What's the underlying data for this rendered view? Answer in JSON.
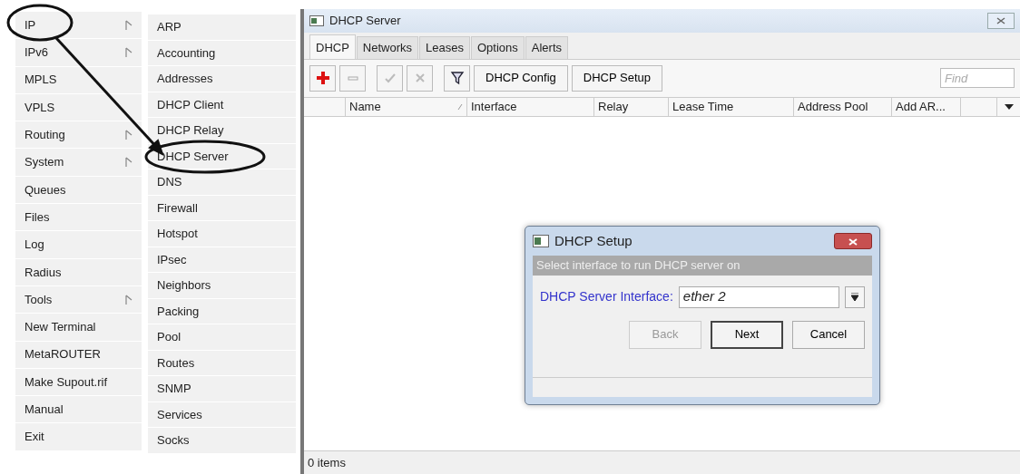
{
  "main_menu": [
    {
      "label": "IP",
      "submenu": true,
      "circled": true
    },
    {
      "label": "IPv6",
      "submenu": true,
      "circled": false
    },
    {
      "label": "MPLS",
      "submenu": false,
      "circled": false
    },
    {
      "label": "VPLS",
      "submenu": false,
      "circled": false
    },
    {
      "label": "Routing",
      "submenu": true,
      "circled": false
    },
    {
      "label": "System",
      "submenu": true,
      "circled": false
    },
    {
      "label": "Queues",
      "submenu": false,
      "circled": false
    },
    {
      "label": "Files",
      "submenu": false,
      "circled": false
    },
    {
      "label": "Log",
      "submenu": false,
      "circled": false
    },
    {
      "label": "Radius",
      "submenu": false,
      "circled": false
    },
    {
      "label": "Tools",
      "submenu": true,
      "circled": false
    },
    {
      "label": "New Terminal",
      "submenu": false,
      "circled": false
    },
    {
      "label": "MetaROUTER",
      "submenu": false,
      "circled": false
    },
    {
      "label": "Make Supout.rif",
      "submenu": false,
      "circled": false
    },
    {
      "label": "Manual",
      "submenu": false,
      "circled": false
    },
    {
      "label": "Exit",
      "submenu": false,
      "circled": false
    }
  ],
  "ip_submenu": [
    {
      "label": "ARP",
      "circled": false
    },
    {
      "label": "Accounting",
      "circled": false
    },
    {
      "label": "Addresses",
      "circled": false
    },
    {
      "label": "DHCP Client",
      "circled": false
    },
    {
      "label": "DHCP Relay",
      "circled": false
    },
    {
      "label": "DHCP Server",
      "circled": true
    },
    {
      "label": "DNS",
      "circled": false
    },
    {
      "label": "Firewall",
      "circled": false
    },
    {
      "label": "Hotspot",
      "circled": false
    },
    {
      "label": "IPsec",
      "circled": false
    },
    {
      "label": "Neighbors",
      "circled": false
    },
    {
      "label": "Packing",
      "circled": false
    },
    {
      "label": "Pool",
      "circled": false
    },
    {
      "label": "Routes",
      "circled": false
    },
    {
      "label": "SNMP",
      "circled": false
    },
    {
      "label": "Services",
      "circled": false
    },
    {
      "label": "Socks",
      "circled": false
    }
  ],
  "window": {
    "title": "DHCP Server",
    "tabs": [
      {
        "label": "DHCP",
        "selected": true
      },
      {
        "label": "Networks",
        "selected": false
      },
      {
        "label": "Leases",
        "selected": false
      },
      {
        "label": "Options",
        "selected": false
      },
      {
        "label": "Alerts",
        "selected": false
      }
    ],
    "toolbar": [
      {
        "kind": "add",
        "disabled": false
      },
      {
        "kind": "remove",
        "disabled": true
      },
      {
        "kind": "enable",
        "disabled": true
      },
      {
        "kind": "disable",
        "disabled": true
      },
      {
        "kind": "filter",
        "disabled": false
      },
      {
        "kind": "text",
        "label": "DHCP Config"
      },
      {
        "kind": "text",
        "label": "DHCP Setup"
      }
    ],
    "find_placeholder": "Find",
    "columns": [
      {
        "label": "Name",
        "sorted": true
      },
      {
        "label": "Interface",
        "sorted": false
      },
      {
        "label": "Relay",
        "sorted": false
      },
      {
        "label": "Lease Time",
        "sorted": false
      },
      {
        "label": "Address Pool",
        "sorted": false
      },
      {
        "label": "Add AR...",
        "sorted": false
      }
    ],
    "status": "0 items"
  },
  "dialog": {
    "title": "DHCP Setup",
    "prompt": "Select interface to run DHCP server on",
    "field_label": "DHCP Server Interface:",
    "field_value": "ether 2",
    "buttons": [
      {
        "label": "Back",
        "disabled": true,
        "default": false
      },
      {
        "label": "Next",
        "disabled": false,
        "default": true
      },
      {
        "label": "Cancel",
        "disabled": false,
        "default": false
      }
    ]
  }
}
